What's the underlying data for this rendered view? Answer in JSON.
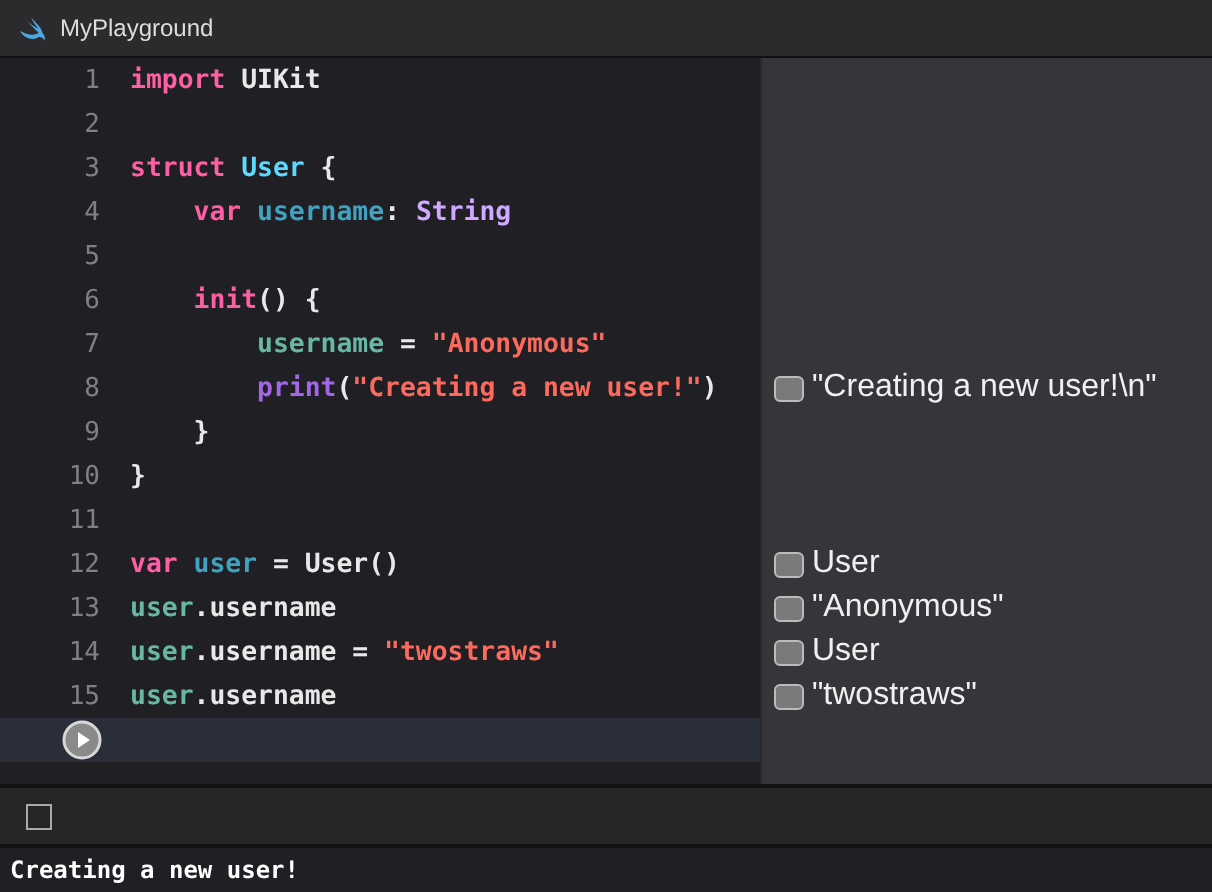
{
  "window": {
    "title": "MyPlayground"
  },
  "editor": {
    "lines": [
      {
        "number": "1",
        "tokens": [
          {
            "kind": "keyword",
            "text": "import"
          },
          {
            "kind": "plain",
            "text": " UIKit"
          }
        ]
      },
      {
        "number": "2"
      },
      {
        "number": "3",
        "tokens": [
          {
            "kind": "keyword",
            "text": "struct "
          },
          {
            "kind": "type",
            "text": "User"
          },
          {
            "kind": "plain",
            "text": " {"
          }
        ]
      },
      {
        "number": "4",
        "tokens": [
          {
            "kind": "keyword",
            "text": "    var "
          },
          {
            "kind": "decl",
            "text": "username"
          },
          {
            "kind": "plain",
            "text": ": "
          },
          {
            "kind": "builtin",
            "text": "String"
          }
        ]
      },
      {
        "number": "5"
      },
      {
        "number": "6",
        "tokens": [
          {
            "kind": "keyword",
            "text": "    init"
          },
          {
            "kind": "plain",
            "text": "() {"
          }
        ]
      },
      {
        "number": "7",
        "tokens": [
          {
            "kind": "member",
            "text": "        username"
          },
          {
            "kind": "plain",
            "text": " = "
          },
          {
            "kind": "string",
            "text": "\"Anonymous\""
          }
        ]
      },
      {
        "number": "8",
        "tokens": [
          {
            "kind": "func",
            "text": "        print"
          },
          {
            "kind": "plain",
            "text": "("
          },
          {
            "kind": "string",
            "text": "\"Creating a new user!\""
          },
          {
            "kind": "plain",
            "text": ")"
          }
        ],
        "result": "\"Creating a new user!\\n\""
      },
      {
        "number": "9",
        "tokens": [
          {
            "kind": "plain",
            "text": "    }"
          }
        ]
      },
      {
        "number": "10",
        "tokens": [
          {
            "kind": "plain",
            "text": "}"
          }
        ]
      },
      {
        "number": "11"
      },
      {
        "number": "12",
        "tokens": [
          {
            "kind": "keyword",
            "text": "var "
          },
          {
            "kind": "decl",
            "text": "user"
          },
          {
            "kind": "plain",
            "text": " = User()"
          }
        ],
        "result": "User"
      },
      {
        "number": "13",
        "tokens": [
          {
            "kind": "member",
            "text": "user"
          },
          {
            "kind": "plain",
            "text": ".username"
          }
        ],
        "result": "\"Anonymous\""
      },
      {
        "number": "14",
        "tokens": [
          {
            "kind": "member",
            "text": "user"
          },
          {
            "kind": "plain",
            "text": ".username = "
          },
          {
            "kind": "string",
            "text": "\"twostraws\""
          }
        ],
        "result": "User"
      },
      {
        "number": "15",
        "tokens": [
          {
            "kind": "member",
            "text": "user"
          },
          {
            "kind": "plain",
            "text": ".username"
          }
        ],
        "result": "\"twostraws\""
      }
    ]
  },
  "console": {
    "output": "Creating a new user!"
  }
}
